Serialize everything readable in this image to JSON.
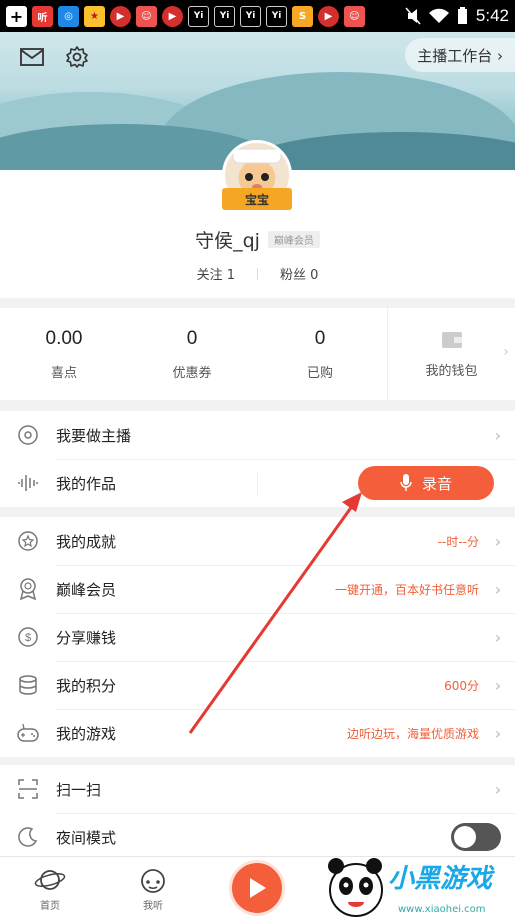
{
  "status_bar": {
    "time": "5:42",
    "app_icons": [
      "plus-icon",
      "ting-app-icon",
      "browser-icon",
      "star-app-icon",
      "video-app-icon",
      "avatar-app-icon",
      "video-app-icon",
      "yi-app-icon",
      "yi-app-icon",
      "yi-app-icon",
      "yi-app-icon",
      "sogou-app-icon",
      "video-app-icon",
      "avatar-app-icon"
    ],
    "ting_label": "听",
    "yi_label": "Yi"
  },
  "header": {
    "mail_icon": "mail-icon",
    "settings_icon": "gear-icon",
    "workbench_label": "主播工作台 ›"
  },
  "profile": {
    "avatar_badge": "宝宝",
    "username": "守侯_qj",
    "vip_tag": "巅峰会员",
    "following": "关注 1",
    "fans": "粉丝 0"
  },
  "stats": [
    {
      "value": "0.00",
      "label": "喜点"
    },
    {
      "value": "0",
      "label": "优惠券"
    },
    {
      "value": "0",
      "label": "已购"
    }
  ],
  "wallet": {
    "label": "我的钱包",
    "icon": "wallet-icon"
  },
  "menu_group1": [
    {
      "label": "我要做主播",
      "icon": "broadcast-icon"
    },
    {
      "label": "我的作品",
      "icon": "waveform-icon",
      "record_label": "录音"
    }
  ],
  "menu_group2": [
    {
      "label": "我的成就",
      "icon": "star-badge-icon",
      "value": "--时--分"
    },
    {
      "label": "巅峰会员",
      "icon": "medal-icon",
      "value": "一键开通，百本好书任意听"
    },
    {
      "label": "分享赚钱",
      "icon": "dollar-icon",
      "value": ""
    },
    {
      "label": "我的积分",
      "icon": "coins-icon",
      "value": "600分"
    },
    {
      "label": "我的游戏",
      "icon": "gamepad-icon",
      "value": "边听边玩，海量优质游戏"
    }
  ],
  "menu_group3": [
    {
      "label": "扫一扫",
      "icon": "scan-icon"
    },
    {
      "label": "夜间模式",
      "icon": "moon-icon"
    }
  ],
  "bottom_nav": [
    {
      "label": "首页",
      "icon": "planet-icon"
    },
    {
      "label": "我听",
      "icon": "headphones-icon"
    }
  ],
  "watermark": {
    "text": "小黑游戏",
    "url": "www.xiaohei.com"
  },
  "colors": {
    "accent": "#f45e3a",
    "value_text": "#f0603a"
  }
}
